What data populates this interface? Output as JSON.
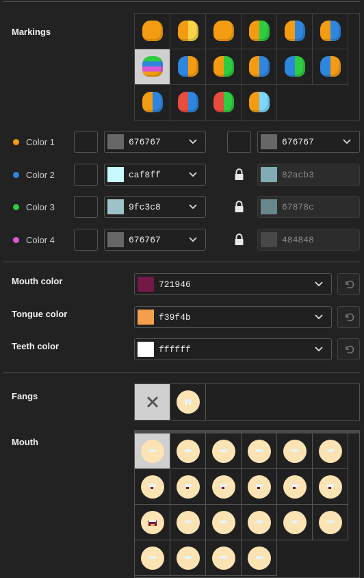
{
  "sections": {
    "markings_label": "Markings",
    "mouth_color_label": "Mouth color",
    "tongue_color_label": "Tongue color",
    "teeth_color_label": "Teeth color",
    "fangs_label": "Fangs",
    "mouth_label": "Mouth"
  },
  "markings": {
    "selected_index": 6,
    "count": 16
  },
  "colors": [
    {
      "label": "Color 1",
      "dot": "#f39c12",
      "primary_hex": "676767",
      "primary_swatch": "#676767",
      "secondary_hex": "676767",
      "secondary_swatch": "#676767",
      "locked": false
    },
    {
      "label": "Color 2",
      "dot": "#2e86de",
      "primary_hex": "caf8ff",
      "primary_swatch": "#caf8ff",
      "secondary_hex": "82acb3",
      "secondary_swatch": "#82acb3",
      "locked": true
    },
    {
      "label": "Color 3",
      "dot": "#2ecc40",
      "primary_hex": "9fc3c8",
      "primary_swatch": "#9fc3c8",
      "secondary_hex": "67878c",
      "secondary_swatch": "#67878c",
      "locked": true
    },
    {
      "label": "Color 4",
      "dot": "#d65ad6",
      "primary_hex": "676767",
      "primary_swatch": "#676767",
      "secondary_hex": "484848",
      "secondary_swatch": "#484848",
      "locked": true
    }
  ],
  "mouth_color": {
    "hex": "721946",
    "swatch": "#721946"
  },
  "tongue_color": {
    "hex": "f39f4b",
    "swatch": "#f39f4b"
  },
  "teeth_color": {
    "hex": "ffffff",
    "swatch": "#ffffff"
  },
  "fangs": {
    "selected": "none"
  },
  "mouth": {
    "selected_index": 0,
    "count": 22
  }
}
